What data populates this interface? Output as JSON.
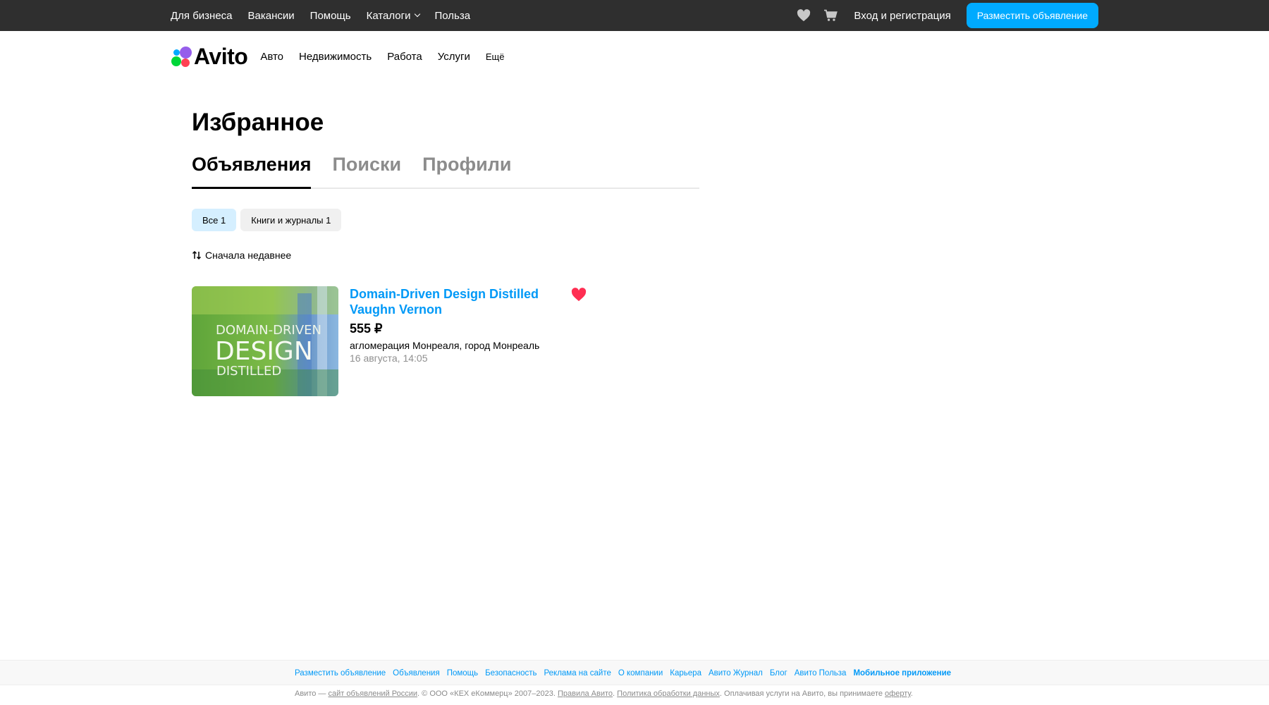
{
  "topbar": {
    "nav": [
      "Для бизнеса",
      "Вакансии",
      "Помощь",
      "Каталоги",
      "Польза"
    ],
    "login": "Вход и регистрация",
    "post_button": "Разместить объявление"
  },
  "header": {
    "logo_text": "Avito",
    "categories": [
      "Авто",
      "Недвижимость",
      "Работа",
      "Услуги"
    ],
    "more": "Ещё"
  },
  "page": {
    "title": "Избранное",
    "tabs": [
      "Объявления",
      "Поиски",
      "Профили"
    ],
    "chips": [
      "Все 1",
      "Книги и журналы 1"
    ],
    "sort_label": "Сначала недавнее"
  },
  "item": {
    "title": "Domain-Driven Design Distilled Vaughn Vernon",
    "price": "555 ₽",
    "location": "агломерация Монреаля, город Монреаль",
    "date": "16 августа, 14:05",
    "cover_lines": [
      "DOMAIN-DRIVEN",
      "DESIGN",
      "DISTILLED"
    ]
  },
  "footer": {
    "links": [
      "Разместить объявление",
      "Объявления",
      "Помощь",
      "Безопасность",
      "Реклама на сайте",
      "О компании",
      "Карьера",
      "Авито Журнал",
      "Блог",
      "Авито Польза",
      "Мобильное приложение"
    ],
    "copyright": {
      "prefix": "Авито — ",
      "site_link": "сайт объявлений России",
      "middle": ". © ООО «КЕХ еКоммерц» 2007–2023. ",
      "rules_link": "Правила Авито",
      "sep": ". ",
      "policy_link": "Политика обработки данных",
      "tail": ". Оплачивая услуги на Авито, вы принимаете ",
      "offer_link": "оферту",
      "end": "."
    }
  },
  "colors": {
    "topbar_bg": "#2f2f2f",
    "accent": "#00aaff",
    "link": "#0099f7",
    "favorite": "#ff2e52",
    "chip_active": "#d5efff"
  }
}
